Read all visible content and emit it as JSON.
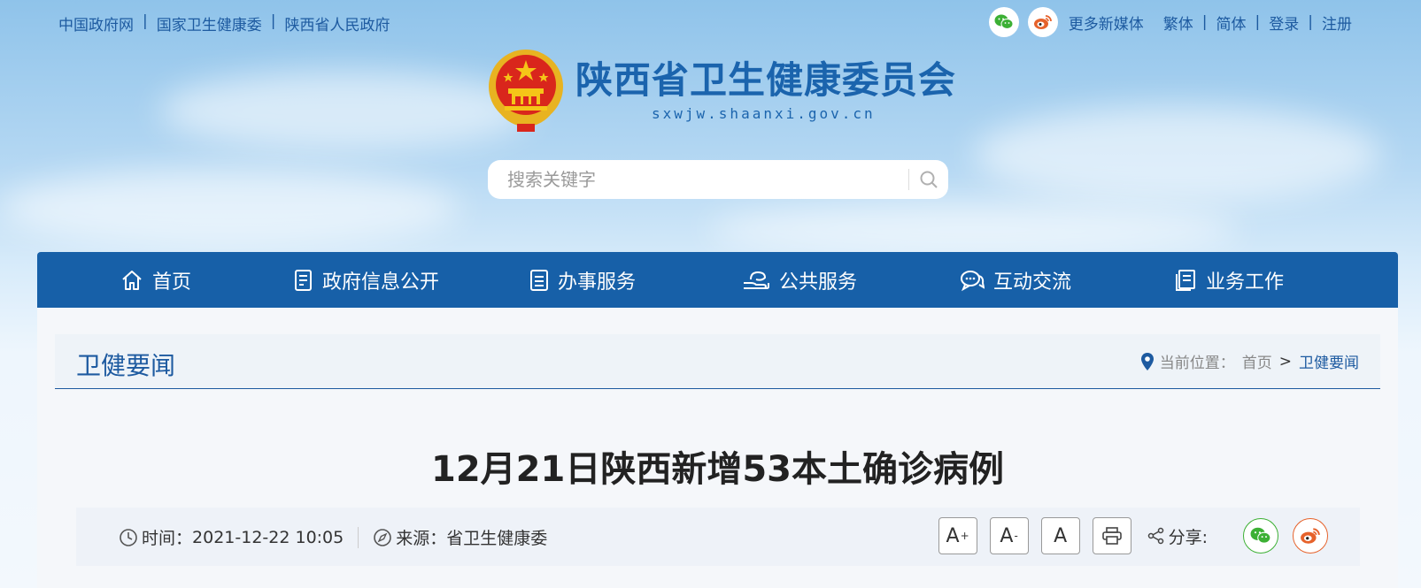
{
  "top_links": [
    "中国政府网",
    "国家卫生健康委",
    "陕西省人民政府"
  ],
  "top_right": {
    "more_media": "更多新媒体",
    "traditional": "繁体",
    "simplified": "简体",
    "login": "登录",
    "register": "注册"
  },
  "site": {
    "name_cn": "陕西省卫生健康委员会",
    "domain": "sxwjw.shaanxi.gov.cn"
  },
  "search": {
    "placeholder": "搜索关键字"
  },
  "nav": [
    {
      "label": "首页",
      "icon": "home-icon"
    },
    {
      "label": "政府信息公开",
      "icon": "document-icon"
    },
    {
      "label": "办事服务",
      "icon": "clipboard-icon"
    },
    {
      "label": "公共服务",
      "icon": "hand-icon"
    },
    {
      "label": "互动交流",
      "icon": "chat-icon"
    },
    {
      "label": "业务工作",
      "icon": "book-icon"
    }
  ],
  "section": {
    "title": "卫健要闻",
    "breadcrumb_label": "当前位置：",
    "breadcrumb_home": "首页",
    "breadcrumb_arrow": ">",
    "breadcrumb_current": "卫健要闻"
  },
  "article": {
    "title": "12月21日陕西新增53本土确诊病例",
    "time_label": "时间：",
    "time_value": "2021-12-22 10:05",
    "source_label": "来源：",
    "source_value": "省卫生健康委",
    "share_label": "分享:"
  },
  "colors": {
    "brand": "#1760a8",
    "wechat": "#3cb034",
    "weibo": "#e6622b"
  }
}
